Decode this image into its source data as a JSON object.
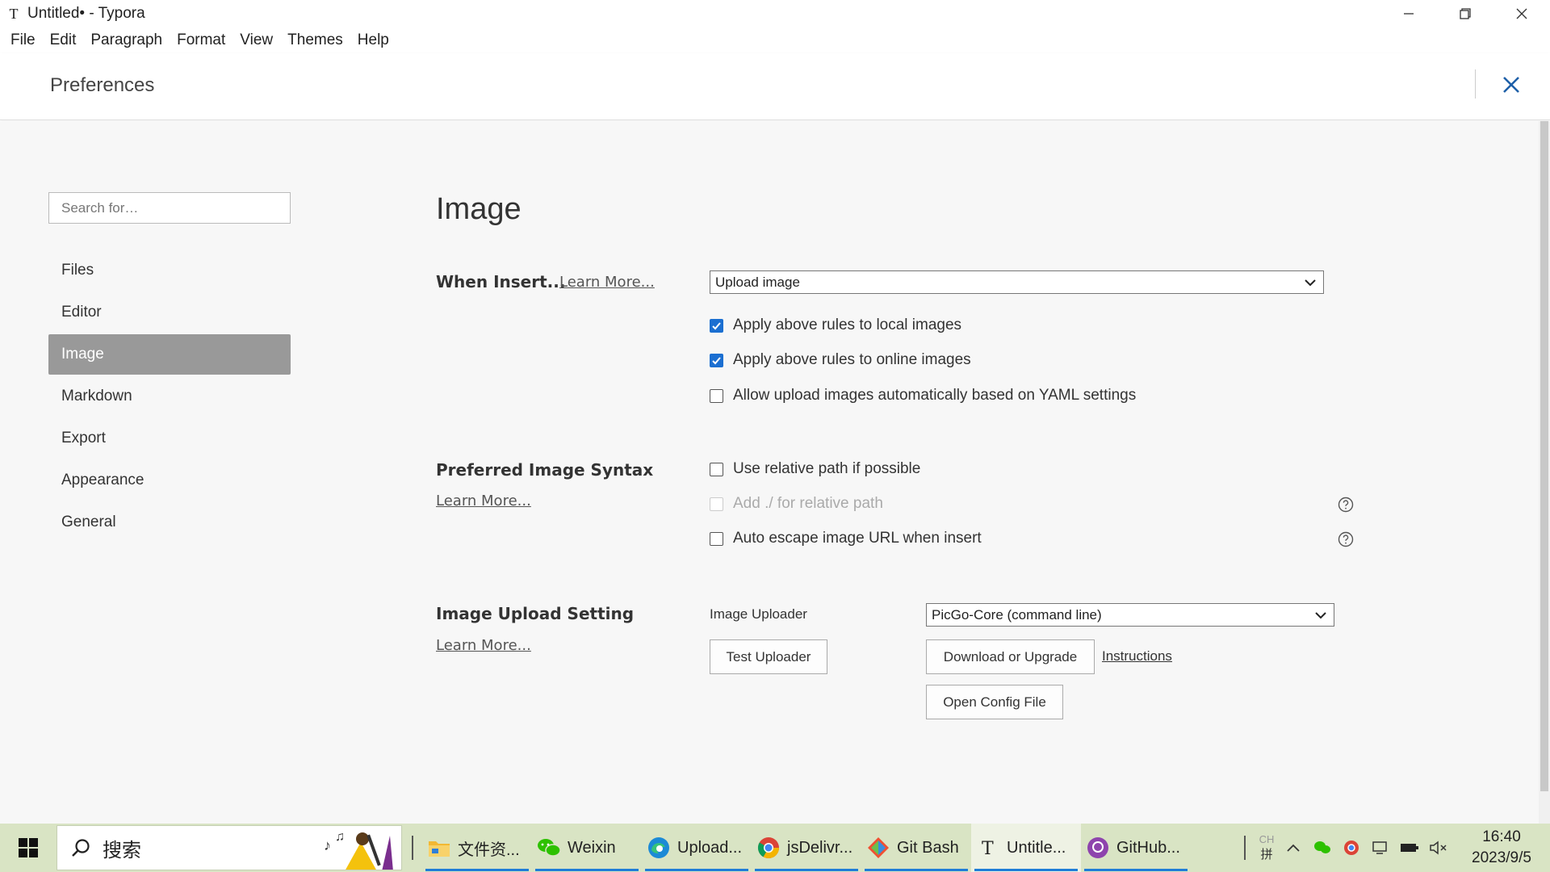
{
  "window": {
    "title": "Untitled• - Typora",
    "app_icon": "T"
  },
  "menu": [
    "File",
    "Edit",
    "Paragraph",
    "Format",
    "View",
    "Themes",
    "Help"
  ],
  "preferences": {
    "title": "Preferences",
    "search_placeholder": "Search for…",
    "nav": [
      "Files",
      "Editor",
      "Image",
      "Markdown",
      "Export",
      "Appearance",
      "General"
    ],
    "active_nav": "Image"
  },
  "image_section": {
    "title": "Image",
    "when_insert": {
      "label": "When Insert...",
      "learn_more": "Learn More...",
      "selected_option": "Upload image",
      "checkboxes": [
        {
          "label": "Apply above rules to local images",
          "checked": true
        },
        {
          "label": "Apply above rules to online images",
          "checked": true
        },
        {
          "label": "Allow upload images automatically based on YAML settings",
          "checked": false
        }
      ]
    },
    "preferred_syntax": {
      "label": "Preferred Image Syntax",
      "learn_more": "Learn More...",
      "checkboxes": [
        {
          "label": "Use relative path if possible",
          "checked": false,
          "disabled": false
        },
        {
          "label": "Add ./ for relative path",
          "checked": false,
          "disabled": true
        },
        {
          "label": "Auto escape image URL when insert",
          "checked": false,
          "disabled": false
        }
      ]
    },
    "upload_setting": {
      "label": "Image Upload Setting",
      "learn_more": "Learn More...",
      "uploader_label": "Image Uploader",
      "uploader_selected": "PicGo-Core (command line)",
      "test_button": "Test Uploader",
      "download_button": "Download or Upgrade",
      "instructions_link": "Instructions",
      "open_config_button": "Open Config File"
    }
  },
  "taskbar": {
    "search_text": "搜索",
    "items": [
      {
        "label": "文件资...",
        "icon": "folder-icon",
        "color": "#f2b833"
      },
      {
        "label": "Weixin",
        "icon": "wechat-icon",
        "color": "#2dc100"
      },
      {
        "label": "Upload...",
        "icon": "edge-icon",
        "color": "#1c8ad6"
      },
      {
        "label": "jsDelivr...",
        "icon": "chrome-icon",
        "color": "#db4437"
      },
      {
        "label": "Git Bash",
        "icon": "git-bash-icon",
        "color": "#f05032"
      },
      {
        "label": "Untitle...",
        "icon": "typora-icon",
        "color": "#333333"
      },
      {
        "label": "GitHub...",
        "icon": "github-desktop-icon",
        "color": "#8e44ad"
      }
    ],
    "ime_top": "CH",
    "ime_bottom": "拼",
    "time": "16:40",
    "date": "2023/9/5"
  }
}
